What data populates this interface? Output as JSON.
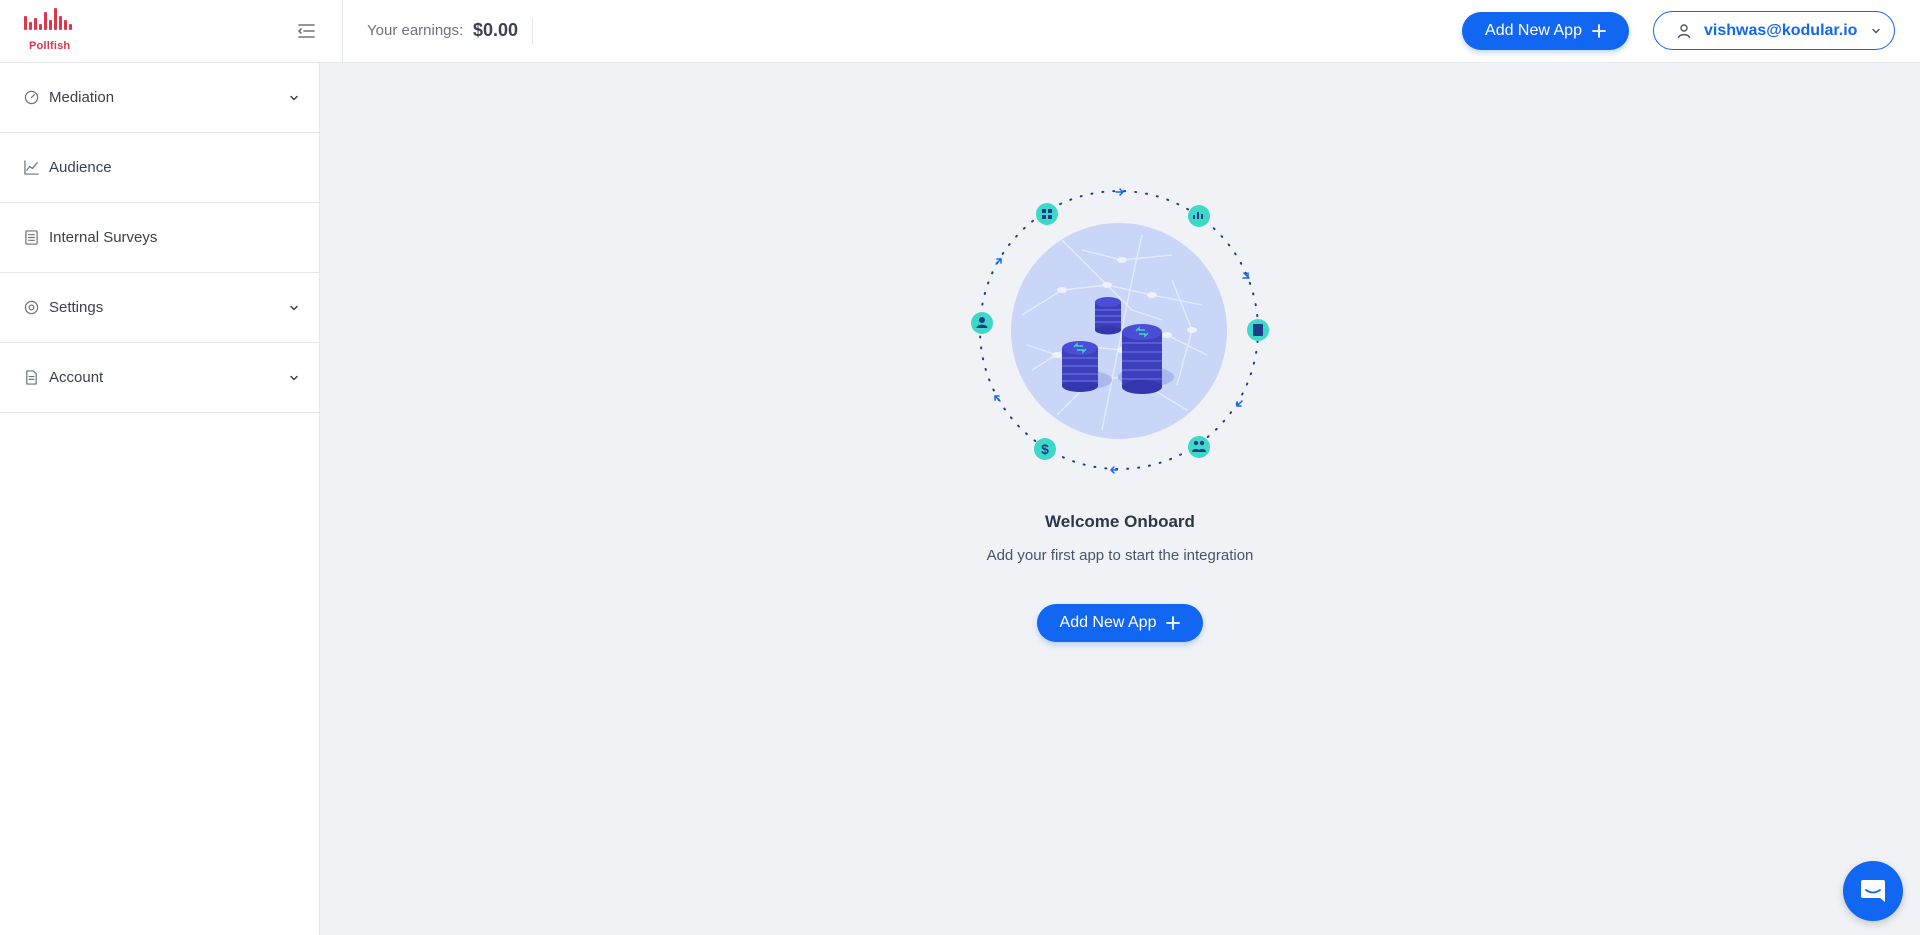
{
  "brand": {
    "name": "Pollfish",
    "color": "#e0344a"
  },
  "header": {
    "earnings_label": "Your earnings:",
    "earnings_value": "$0.00",
    "add_app_label": "Add New App",
    "user_email": "vishwas@kodular.io"
  },
  "sidebar": {
    "items": [
      {
        "label": "Mediation",
        "icon": "gauge-icon",
        "expandable": true
      },
      {
        "label": "Audience",
        "icon": "line-chart-icon",
        "expandable": false
      },
      {
        "label": "Internal Surveys",
        "icon": "list-icon",
        "expandable": false
      },
      {
        "label": "Settings",
        "icon": "gear-icon",
        "expandable": true
      },
      {
        "label": "Account",
        "icon": "document-icon",
        "expandable": true
      }
    ]
  },
  "main": {
    "title": "Welcome Onboard",
    "subtitle": "Add your first app to start the integration",
    "add_app_label": "Add New App"
  },
  "colors": {
    "accent": "#1166f2",
    "teal": "#3dd9c8",
    "background": "#f0f2f6"
  }
}
